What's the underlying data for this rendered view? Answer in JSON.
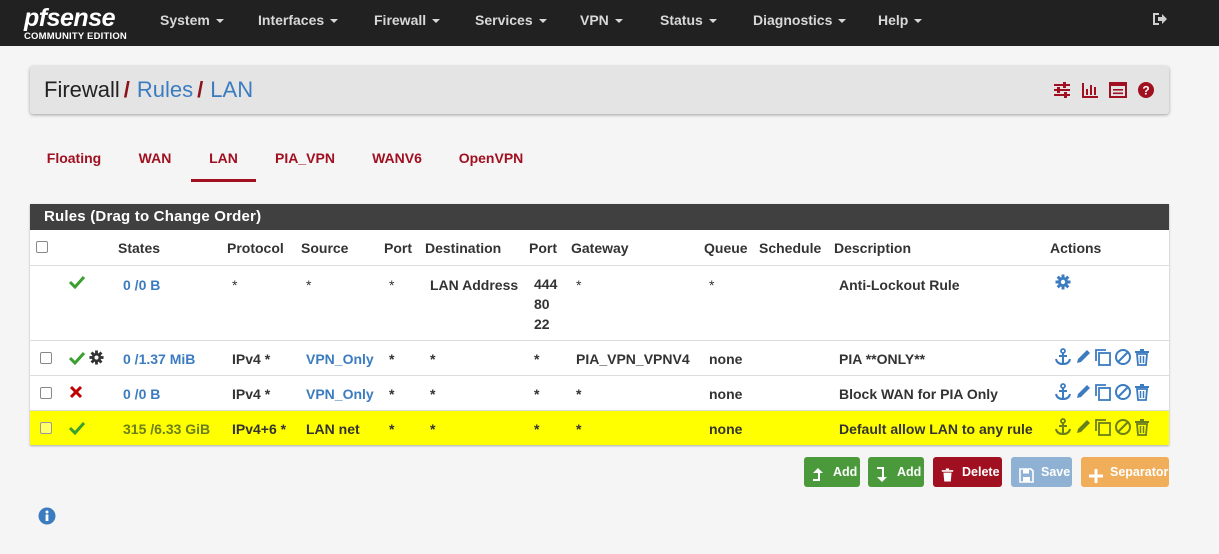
{
  "app": {
    "brand": "pfsense",
    "brand_prefix": "pf",
    "brand_suffix": "sense",
    "edition": "COMMUNITY EDITION"
  },
  "nav": {
    "items": [
      {
        "label": "System"
      },
      {
        "label": "Interfaces"
      },
      {
        "label": "Firewall"
      },
      {
        "label": "Services"
      },
      {
        "label": "VPN"
      },
      {
        "label": "Status"
      },
      {
        "label": "Diagnostics"
      },
      {
        "label": "Help"
      }
    ],
    "logout_icon": "sign-out-icon"
  },
  "breadcrumb": {
    "items": [
      "Firewall",
      "Rules",
      "LAN"
    ],
    "separator": "/",
    "icons": [
      "sliders-icon",
      "bar-chart-icon",
      "list-icon",
      "help-icon"
    ]
  },
  "tabs": [
    {
      "label": "Floating",
      "active": false
    },
    {
      "label": "WAN",
      "active": false
    },
    {
      "label": "LAN",
      "active": true
    },
    {
      "label": "PIA_VPN",
      "active": false
    },
    {
      "label": "WANV6",
      "active": false
    },
    {
      "label": "OpenVPN",
      "active": false
    }
  ],
  "rules_panel": {
    "title": "Rules (Drag to Change Order)",
    "columns": [
      "States",
      "Protocol",
      "Source",
      "Port",
      "Destination",
      "Port",
      "Gateway",
      "Queue",
      "Schedule",
      "Description",
      "Actions"
    ],
    "rows": [
      {
        "status": "pass",
        "states": "0 /0 B",
        "protocol": "*",
        "source": "*",
        "source_port": "*",
        "destination": "LAN Address",
        "dest_port_lines": [
          "444",
          "80",
          "22"
        ],
        "gateway": "*",
        "queue": "*",
        "schedule": "",
        "description": "Anti-Lockout Rule",
        "actions": [
          "gear-icon"
        ]
      },
      {
        "status": "pass",
        "has_gear": true,
        "states": "0 /1.37 MiB",
        "protocol": "IPv4 *",
        "source": "VPN_Only",
        "source_port": "*",
        "destination": "*",
        "dest_port": "*",
        "gateway": "PIA_VPN_VPNV4",
        "queue": "none",
        "schedule": "",
        "description": "PIA **ONLY**",
        "actions": [
          "anchor-icon",
          "pencil-icon",
          "copy-icon",
          "ban-icon",
          "trash-icon"
        ]
      },
      {
        "status": "block",
        "states": "0 /0 B",
        "protocol": "IPv4 *",
        "source": "VPN_Only",
        "source_port": "*",
        "destination": "*",
        "dest_port": "*",
        "gateway": "*",
        "queue": "none",
        "schedule": "",
        "description": "Block WAN for PIA Only",
        "actions": [
          "anchor-icon",
          "pencil-icon",
          "copy-icon",
          "ban-icon",
          "trash-icon"
        ]
      },
      {
        "status": "pass",
        "highlighted": true,
        "states": "315 /6.33 GiB",
        "protocol": "IPv4+6 *",
        "source": "LAN net",
        "source_port": "*",
        "destination": "*",
        "dest_port": "*",
        "gateway": "*",
        "queue": "none",
        "schedule": "",
        "description": "Default allow LAN to any rule",
        "actions": [
          "anchor-icon",
          "pencil-icon",
          "copy-icon",
          "ban-icon",
          "trash-icon"
        ]
      }
    ]
  },
  "buttons": [
    {
      "label": "Add",
      "icon": "arrow-turn-up-icon",
      "color": "#4a9a3c"
    },
    {
      "label": "Add",
      "icon": "arrow-turn-down-icon",
      "color": "#4a9a3c"
    },
    {
      "label": "Delete",
      "icon": "trash-icon",
      "color": "#a01020"
    },
    {
      "label": "Save",
      "icon": "floppy-icon",
      "color": "#8fb1d4"
    },
    {
      "label": "Separator",
      "icon": "plus-icon",
      "color": "#f0ad5a"
    }
  ],
  "footer": {
    "info_icon": "info-circle-icon"
  },
  "colors": {
    "navbar": "#212121",
    "accent": "#a01020",
    "link": "#3b7cc0",
    "pass": "#3aa030",
    "block": "#c00000",
    "highlight": "#ffff00"
  }
}
